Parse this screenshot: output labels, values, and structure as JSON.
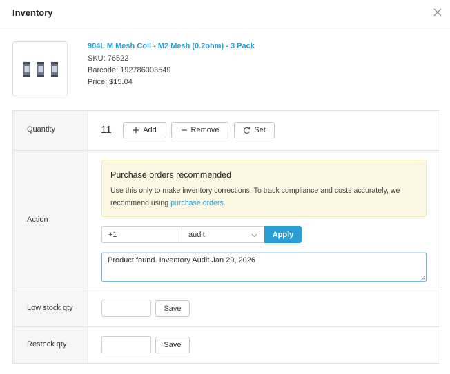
{
  "header": {
    "title": "Inventory",
    "close_icon": "close-icon"
  },
  "product": {
    "image_icon": "vape-coil-pack-image",
    "name": "904L M Mesh Coil - M2 Mesh (0.2ohm) - 3 Pack",
    "sku": "SKU: 76522",
    "barcode": "Barcode: 192786003549",
    "price": "Price: $15.04"
  },
  "rows": {
    "quantity": {
      "label": "Quantity",
      "value": "11",
      "buttons": {
        "add": "Add",
        "remove": "Remove",
        "set": "Set"
      }
    },
    "action": {
      "label": "Action",
      "alert": {
        "title": "Purchase orders recommended",
        "body": "Use this only to make inventory corrections. To track compliance and costs accurately, we recommend using ",
        "link": "purchase orders",
        "suffix": "."
      },
      "adjustment_value": "+1",
      "reason_selected": "audit",
      "apply_label": "Apply",
      "note_value": "Product found. Inventory Audit Jan 29, 2026"
    },
    "low_stock": {
      "label": "Low stock qty",
      "value": "",
      "save_label": "Save"
    },
    "restock": {
      "label": "Restock qty",
      "value": "",
      "save_label": "Save"
    }
  },
  "colors": {
    "accent": "#2a9fd6",
    "alert_bg": "#fcf8e3",
    "label_col_bg": "#f6f6f6"
  }
}
